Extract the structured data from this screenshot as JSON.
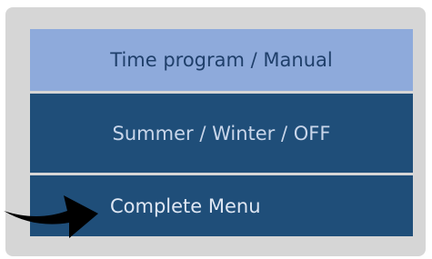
{
  "menu": {
    "items": [
      {
        "label": "Time program / Manual"
      },
      {
        "label": "Summer / Winter / OFF"
      },
      {
        "label": "Complete Menu"
      }
    ]
  },
  "pointer": {
    "icon": "curved-arrow-icon",
    "target": "Complete Menu"
  },
  "colors": {
    "panel_background": "#d6d6d6",
    "highlighted_item": "#8eaadb",
    "item_background": "#1f4e79",
    "arrow": "#000000"
  }
}
